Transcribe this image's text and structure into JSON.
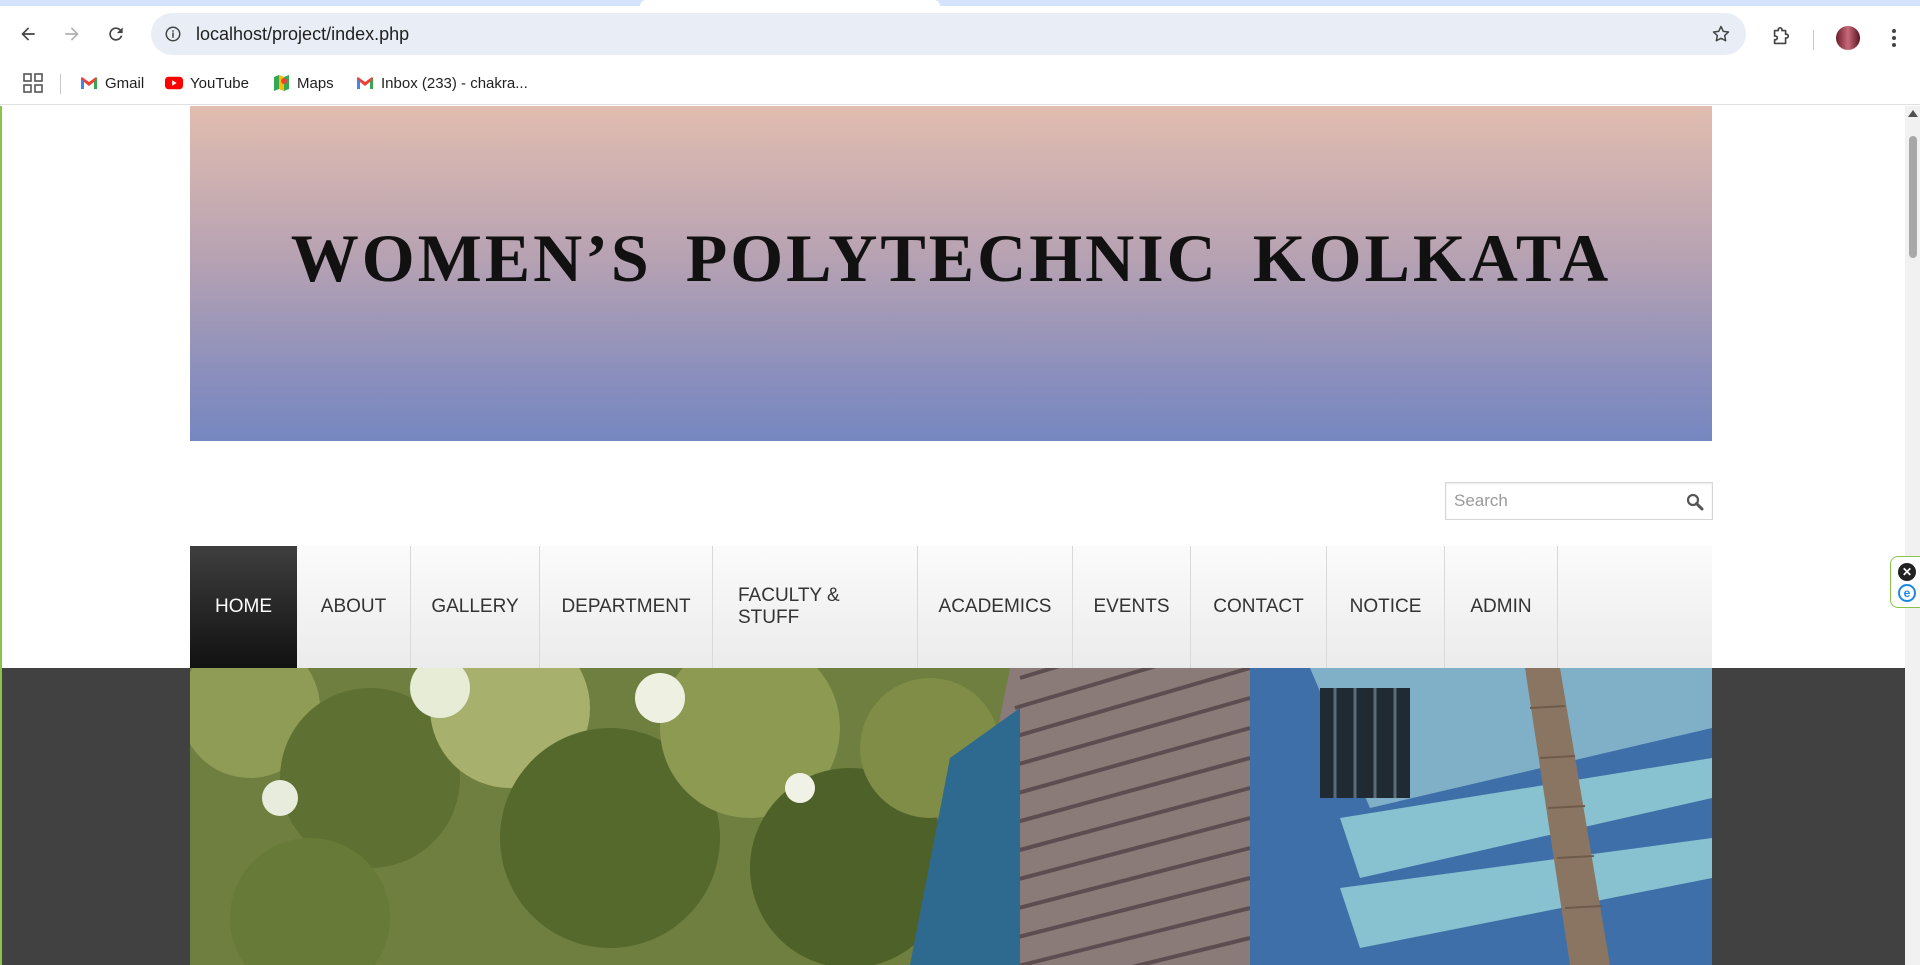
{
  "browser": {
    "url": "localhost/project/index.php",
    "bookmarks": [
      {
        "label": "Gmail",
        "icon": "gmail-icon"
      },
      {
        "label": "YouTube",
        "icon": "youtube-icon"
      },
      {
        "label": "Maps",
        "icon": "maps-icon"
      },
      {
        "label": "Inbox (233) - chakra...",
        "icon": "gmail-icon"
      }
    ]
  },
  "site": {
    "title": "WOMEN’S POLYTECHNIC KOLKATA",
    "search_placeholder": "Search",
    "nav": [
      {
        "label": "HOME",
        "active": true
      },
      {
        "label": "ABOUT"
      },
      {
        "label": "GALLERY"
      },
      {
        "label": "DEPARTMENT"
      },
      {
        "label": "FACULTY & STUFF"
      },
      {
        "label": "ACADEMICS"
      },
      {
        "label": "EVENTS"
      },
      {
        "label": "CONTACT"
      },
      {
        "label": "NOTICE"
      },
      {
        "label": "ADMIN"
      }
    ]
  },
  "colors": {
    "banner_top": "#e2bdb0",
    "banner_bottom": "#7587c0",
    "nav_active": "#111111",
    "dark_band": "#414141"
  }
}
